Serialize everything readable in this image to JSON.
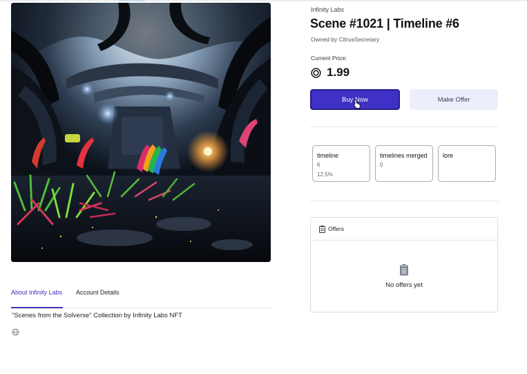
{
  "collection": "Infinity Labs",
  "title": "Scene #1021 | Timeline #6",
  "owner": "Owned by CitrusSecretary",
  "price": {
    "label": "Current Price:",
    "value": "1.99",
    "currency_icon": "coin-icon"
  },
  "buttons": {
    "buy": "Buy Now",
    "offer": "Make Offer"
  },
  "attributes": [
    {
      "name": "timeline",
      "lines": [
        "6",
        "12.5%"
      ]
    },
    {
      "name": "timelines merged",
      "lines": [
        "0"
      ]
    },
    {
      "name": "lore",
      "lines": []
    }
  ],
  "offers": {
    "title": "Offers",
    "empty": "No offers yet"
  },
  "tabs": {
    "about": "About Infinity Labs",
    "account": "Account Details"
  },
  "description": "\"Scenes from the Solverse\" Collection by Infinity Labs NFT",
  "colors": {
    "accent": "#3f31c6",
    "secondary_button": "#eceffb"
  }
}
